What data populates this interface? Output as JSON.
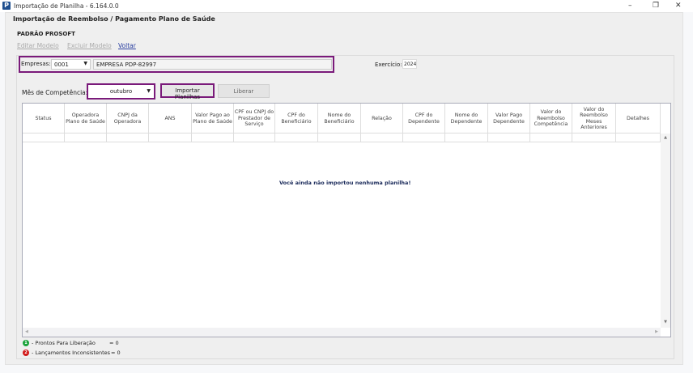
{
  "window": {
    "title": "Importação de Planilha - 6.164.0.0",
    "app_icon": "P",
    "minimize": "–",
    "restore": "❐",
    "close": "✕"
  },
  "heading": "Importação de Reembolso / Pagamento Plano de Saúde",
  "company_title": "PADRÃO PROSOFT",
  "links": {
    "edit": "Editar Modelo",
    "delete": "Excluir Modelo",
    "back": "Voltar"
  },
  "filters": {
    "empresas_label": "Empresas:",
    "empresa_code": "0001",
    "empresa_name": "EMPRESA PDP-82997",
    "exercicio_label": "Exercício:",
    "exercicio_value": "2024",
    "mes_label": "Mês de Competência:",
    "mes_value": "outubro"
  },
  "buttons": {
    "import": "Importar Planilhas",
    "release": "Liberar"
  },
  "columns": [
    "Status",
    "Operadora Plano de Saúde",
    "CNPJ da Operadora",
    "ANS",
    "Valor Pago ao Plano de Saúde",
    "CPF ou CNPJ do Prestador de Serviço",
    "CPF do Beneficiário",
    "Nome do Beneficiário",
    "Relação",
    "CPF do Dependente",
    "Nome do Dependente",
    "Valor Pago Dependente",
    "Valor do Reembolso Competência",
    "Valor do Reembolso Meses Anteriores",
    "Detalhes"
  ],
  "empty_message": "Você ainda não importou nenhuma planilha!",
  "legend": [
    {
      "icon": "1",
      "label": "- Prontos Para Liberação",
      "count": "= 0",
      "color": "#1aa33a"
    },
    {
      "icon": "2",
      "label": "- Lançamentos Inconsistentes",
      "count": "= 0",
      "color": "#d11a1a"
    }
  ]
}
